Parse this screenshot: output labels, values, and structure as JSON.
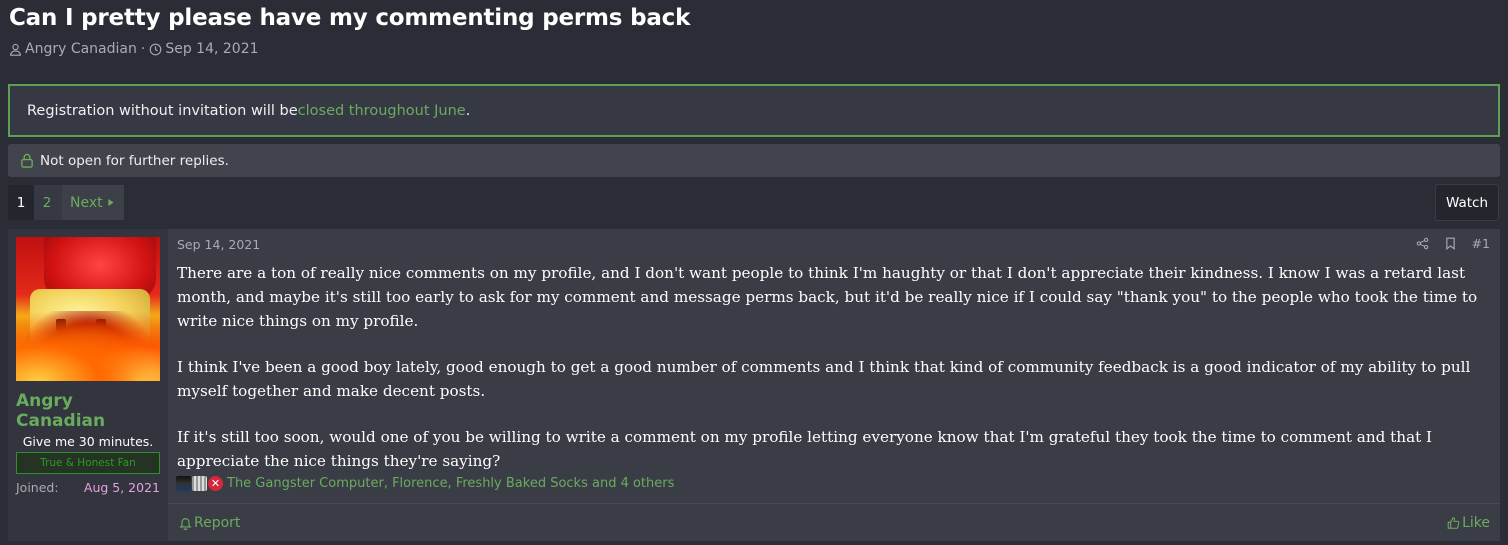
{
  "thread": {
    "title": "Can I pretty please have my commenting perms back",
    "author": "Angry Canadian",
    "separator": "·",
    "date": "Sep 14, 2021"
  },
  "notice": {
    "text_before": "Registration without invitation will be ",
    "link_text": "closed throughout June",
    "text_after": "."
  },
  "locked": {
    "text": "Not open for further replies."
  },
  "pagination": {
    "pages": [
      "1",
      "2"
    ],
    "current": "1",
    "next_label": "Next"
  },
  "watch_label": "Watch",
  "post": {
    "user": {
      "name": "Angry Canadian",
      "title": "Give me 30 minutes.",
      "banner": "True & Honest Fan",
      "joined_label": "Joined:",
      "joined_value": "Aug 5, 2021"
    },
    "date": "Sep 14, 2021",
    "number": "#1",
    "paragraphs": [
      "There are a ton of really nice comments on my profile, and I don't want people to think I'm haughty or that I don't appreciate their kindness. I know I was a retard last month, and maybe it's still too early to ask for my comment and message perms back, but it'd be really nice if I could say \"thank you\" to the people who took the time to write nice things on my profile.",
      "I think I've been a good boy lately, good enough to get a good number of comments and I think that kind of community feedback is a good indicator of my ability to pull myself together and make decent posts.",
      "If it's still too soon, would one of you be willing to write a comment on my profile letting everyone know that I'm grateful they took the time to comment and that I appreciate the nice things they're saying?"
    ],
    "reactions_text": "The Gangster Computer, Florence, Freshly Baked Socks and 4 others",
    "report_label": "Report",
    "like_label": "Like"
  },
  "colors": {
    "accent_green": "#6aac5e",
    "background": "#2b2d36",
    "joined_date": "#e6a0e0"
  }
}
